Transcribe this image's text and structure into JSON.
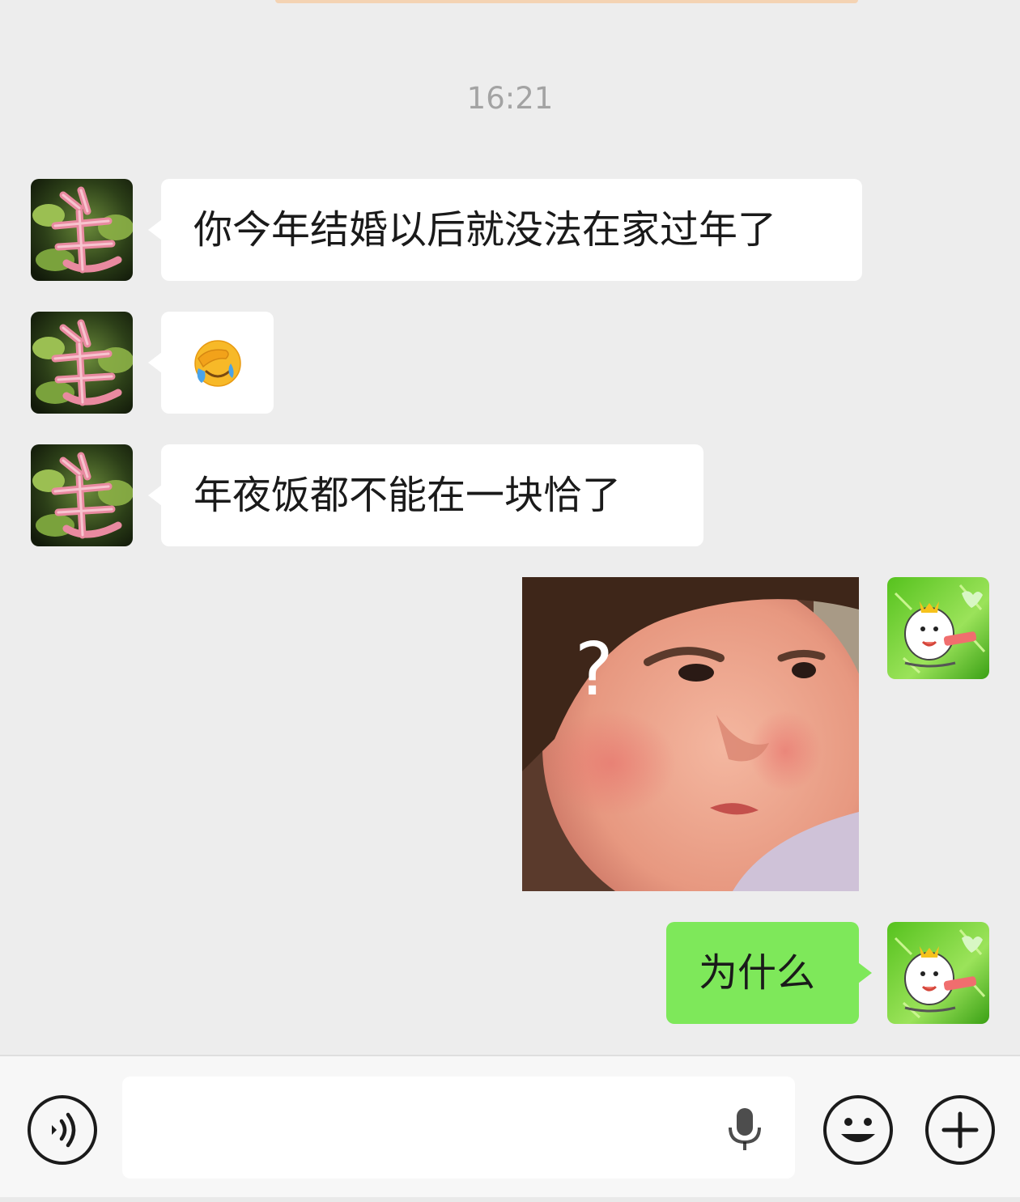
{
  "chat": {
    "timestamp": "16:21",
    "messages": [
      {
        "side": "left",
        "kind": "text",
        "text": "你今年结婚以后就没法在家过年了"
      },
      {
        "side": "left",
        "kind": "emoji",
        "emoji_name": "facepalm-crying-emoji"
      },
      {
        "side": "left",
        "kind": "text",
        "text": "年夜饭都不能在一块恰了"
      },
      {
        "side": "right",
        "kind": "sticker",
        "sticker_name": "confused-kid-sticker",
        "sticker_text": "?"
      },
      {
        "side": "right",
        "kind": "text",
        "text": "为什么"
      }
    ]
  },
  "input_bar": {
    "voice_button_icon": "voice-mode-icon",
    "microphone_icon": "microphone-icon",
    "emoji_button_icon": "smiley-icon",
    "more_button_icon": "plus-icon",
    "input_value": ""
  },
  "colors": {
    "background": "#ededed",
    "bubble_incoming": "#ffffff",
    "bubble_outgoing": "#7ee85a",
    "timestamp_text": "#a3a3a3"
  }
}
